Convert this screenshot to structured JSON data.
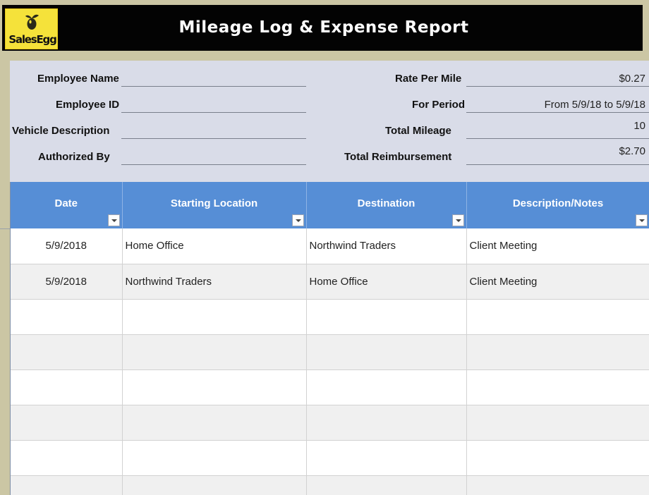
{
  "header": {
    "logo_text": "SalesEgg",
    "title": "Mileage Log & Expense Report"
  },
  "form": {
    "employee_name_label": "Employee Name",
    "employee_name_value": "",
    "employee_id_label": "Employee ID",
    "employee_id_value": "",
    "vehicle_label": "Vehicle Description",
    "vehicle_value": "",
    "authorized_label": "Authorized By",
    "authorized_value": "",
    "rate_label": "Rate Per Mile",
    "rate_value": "$0.27",
    "period_label": "For Period",
    "period_value": "From 5/9/18 to 5/9/18",
    "mileage_label": "Total Mileage",
    "mileage_value": "10",
    "reimbursement_label": "Total Reimbursement",
    "reimbursement_value": "$2.70"
  },
  "table": {
    "columns": [
      "Date",
      "Starting Location",
      "Destination",
      "Description/Notes"
    ],
    "rows": [
      [
        "5/9/2018",
        "Home Office",
        "Northwind Traders",
        "Client Meeting"
      ],
      [
        "5/9/2018",
        "Northwind Traders",
        "Home Office",
        "Client Meeting"
      ],
      [
        "",
        "",
        "",
        ""
      ],
      [
        "",
        "",
        "",
        ""
      ],
      [
        "",
        "",
        "",
        ""
      ],
      [
        "",
        "",
        "",
        ""
      ],
      [
        "",
        "",
        "",
        ""
      ],
      [
        "",
        "",
        "",
        ""
      ]
    ]
  },
  "colors": {
    "title_bar": "#030303",
    "logo_bg": "#f5e23a",
    "header_blue": "#568ed6",
    "form_bg": "#d9dce8"
  }
}
